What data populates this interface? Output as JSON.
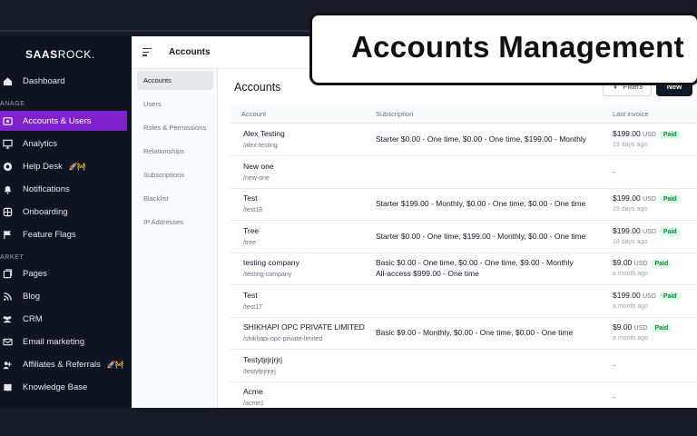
{
  "overlay": {
    "title": "Accounts Management"
  },
  "sidebar": {
    "logo_bold": "SAAS",
    "logo_thin": "ROCK.",
    "items": [
      {
        "label": "Dashboard",
        "icon": "home-icon"
      },
      {
        "label": "Accounts & Users",
        "icon": "users-icon",
        "active": true
      },
      {
        "label": "Analytics",
        "icon": "chart-icon"
      },
      {
        "label": "Help Desk",
        "icon": "help-icon",
        "emoji": "🚀🚧"
      },
      {
        "label": "Notifications",
        "icon": "bell-icon"
      },
      {
        "label": "Onboarding",
        "icon": "onboarding-icon"
      },
      {
        "label": "Feature Flags",
        "icon": "flag-icon"
      },
      {
        "label": "Pages",
        "icon": "pages-icon"
      },
      {
        "label": "Blog",
        "icon": "rss-icon"
      },
      {
        "label": "CRM",
        "icon": "crm-icon"
      },
      {
        "label": "Email marketing",
        "icon": "mail-icon"
      },
      {
        "label": "Affiliates & Referrals",
        "icon": "affiliate-icon",
        "emoji": "🚀🚧"
      },
      {
        "label": "Knowledge Base",
        "icon": "book-icon"
      }
    ],
    "sections": {
      "manage": "ANAGE",
      "market": "ARKET"
    }
  },
  "submenu": {
    "title": "Accounts",
    "items": [
      {
        "label": "Accounts",
        "active": true
      },
      {
        "label": "Users"
      },
      {
        "label": "Roles & Permissions"
      },
      {
        "label": "Relationships"
      },
      {
        "label": "Subscriptions"
      },
      {
        "label": "Blacklist"
      },
      {
        "label": "IP Addresses"
      }
    ]
  },
  "main": {
    "title": "Accounts",
    "filters_label": "Filters",
    "new_label": "New",
    "columns": {
      "account": "Account",
      "subscription": "Subscription",
      "last_invoice": "Last invoice"
    },
    "rows": [
      {
        "name": "Alex Testing",
        "slug": "/alex-testing",
        "subscription": "Starter $0.00 - One time, $0.00 - One time, $199.00 - Monthly",
        "subscription2": "",
        "amount": "$199.00",
        "currency": "USD",
        "status": "Paid",
        "ago": "19 days ago"
      },
      {
        "name": "New one",
        "slug": "/new-one",
        "subscription": "",
        "subscription2": "",
        "amount": "",
        "currency": "",
        "status": "",
        "ago": "",
        "dash": "-"
      },
      {
        "name": "Test",
        "slug": "/test18",
        "subscription": "Starter $199.00 - Monthly, $0.00 - One time, $0.00 - One time",
        "subscription2": "",
        "amount": "$199.00",
        "currency": "USD",
        "status": "Paid",
        "ago": "19 days ago"
      },
      {
        "name": "Tree",
        "slug": "/tree",
        "subscription": "Starter $0.00 - One time, $199.00 - Monthly, $0.00 - One time",
        "subscription2": "",
        "amount": "$199.00",
        "currency": "USD",
        "status": "Paid",
        "ago": "18 days ago"
      },
      {
        "name": "testing company",
        "slug": "/testing-company",
        "subscription": "Basic $0.00 - One time, $0.00 - One time, $9.00 - Monthly",
        "subscription2": "All-access $999.00 - One time",
        "amount": "$9.00",
        "currency": "USD",
        "status": "Paid",
        "ago": "a month ago"
      },
      {
        "name": "Test",
        "slug": "/test17",
        "subscription": "",
        "subscription2": "",
        "amount": "$199.00",
        "currency": "USD",
        "status": "Paid",
        "ago": "a month ago"
      },
      {
        "name": "SHIKHAPI OPC PRIVATE LIMITED",
        "slug": "/shikhapi-opc-private-limited",
        "subscription": "Basic $9.00 - Monthly, $0.00 - One time, $0.00 - One time",
        "subscription2": "",
        "amount": "$9.00",
        "currency": "USD",
        "status": "Paid",
        "ago": "a month ago"
      },
      {
        "name": "Testytjrjrjrjrj",
        "slug": "/testytjrjrjrjrj",
        "subscription": "",
        "subscription2": "",
        "amount": "",
        "currency": "",
        "status": "",
        "ago": "",
        "dash": "-"
      },
      {
        "name": "Acme",
        "slug": "/acme1",
        "subscription": "",
        "subscription2": "",
        "amount": "",
        "currency": "",
        "status": "",
        "ago": "",
        "dash": "-"
      }
    ]
  },
  "colors": {
    "accent": "#7e22ce",
    "sidebar_bg": "#0f1422",
    "paid_bg": "#dcfce7",
    "paid_text": "#15803d"
  }
}
